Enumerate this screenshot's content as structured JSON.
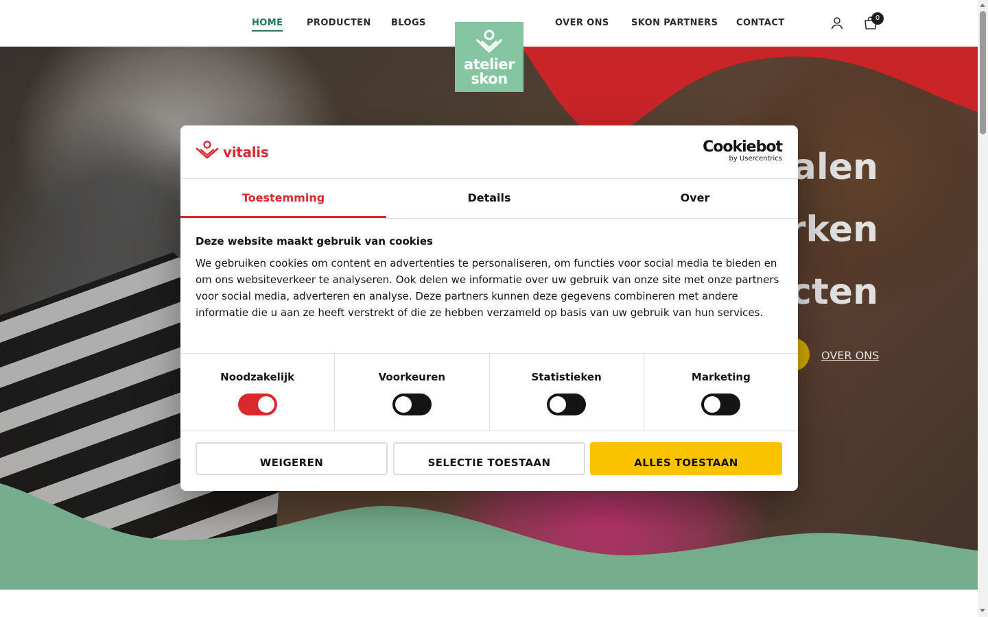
{
  "header": {
    "nav_left": [
      "HOME",
      "PRODUCTEN",
      "BLOGS"
    ],
    "nav_right": [
      "OVER ONS",
      "SKON PARTNERS",
      "CONTACT"
    ],
    "logo_line1": "atelier",
    "logo_line2": "skon",
    "cart_count": "0",
    "icons": [
      "user-icon",
      "cart-icon"
    ]
  },
  "hero": {
    "title_line1": "rialen",
    "title_line2": "erken",
    "title_line3": "ucten",
    "link_label": "OVER ONS"
  },
  "cookie_dialog": {
    "brand_name": "vitalis",
    "provider_name": "Cookiebot",
    "provider_sub": "by Usercentrics",
    "tabs": [
      "Toestemming",
      "Details",
      "Over"
    ],
    "active_tab": "Toestemming",
    "heading": "Deze website maakt gebruik van cookies",
    "description": "We gebruiken cookies om content en advertenties te personaliseren, om functies voor social media te bieden en om ons websiteverkeer te analyseren. Ook delen we informatie over uw gebruik van onze site met onze partners voor social media, adverteren en analyse. Deze partners kunnen deze gegevens combineren met andere informatie die u aan ze heeft verstrekt of die ze hebben verzameld op basis van uw gebruik van hun services.",
    "categories": [
      {
        "label": "Noodzakelijk",
        "enabled": true
      },
      {
        "label": "Voorkeuren",
        "enabled": false
      },
      {
        "label": "Statistieken",
        "enabled": false
      },
      {
        "label": "Marketing",
        "enabled": false
      }
    ],
    "buttons": {
      "deny": "WEIGEREN",
      "allow_selection": "SELECTIE TOESTAAN",
      "allow_all": "ALLES TOESTAAN"
    }
  },
  "colors": {
    "brand_red": "#d9292f",
    "accent_yellow": "#f9c300",
    "brand_green": "#86c5a1",
    "nav_active": "#1f7a58"
  }
}
